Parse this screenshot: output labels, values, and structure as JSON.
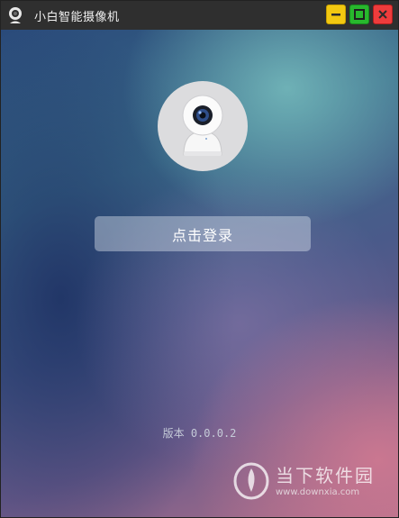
{
  "window": {
    "title": "小白智能摄像机",
    "icon": "camera-app-icon",
    "controls": [
      "minimize",
      "maximize",
      "close"
    ]
  },
  "main": {
    "login_button_label": "点击登录",
    "version_text": "版本 0.0.0.2"
  },
  "watermark": {
    "title": "当下软件园",
    "url": "www.downxia.com"
  },
  "colors": {
    "titlebar": "#2f2f2f",
    "minimize": "#f2c811",
    "maximize": "#28b82d",
    "close": "#ee3c3c"
  }
}
